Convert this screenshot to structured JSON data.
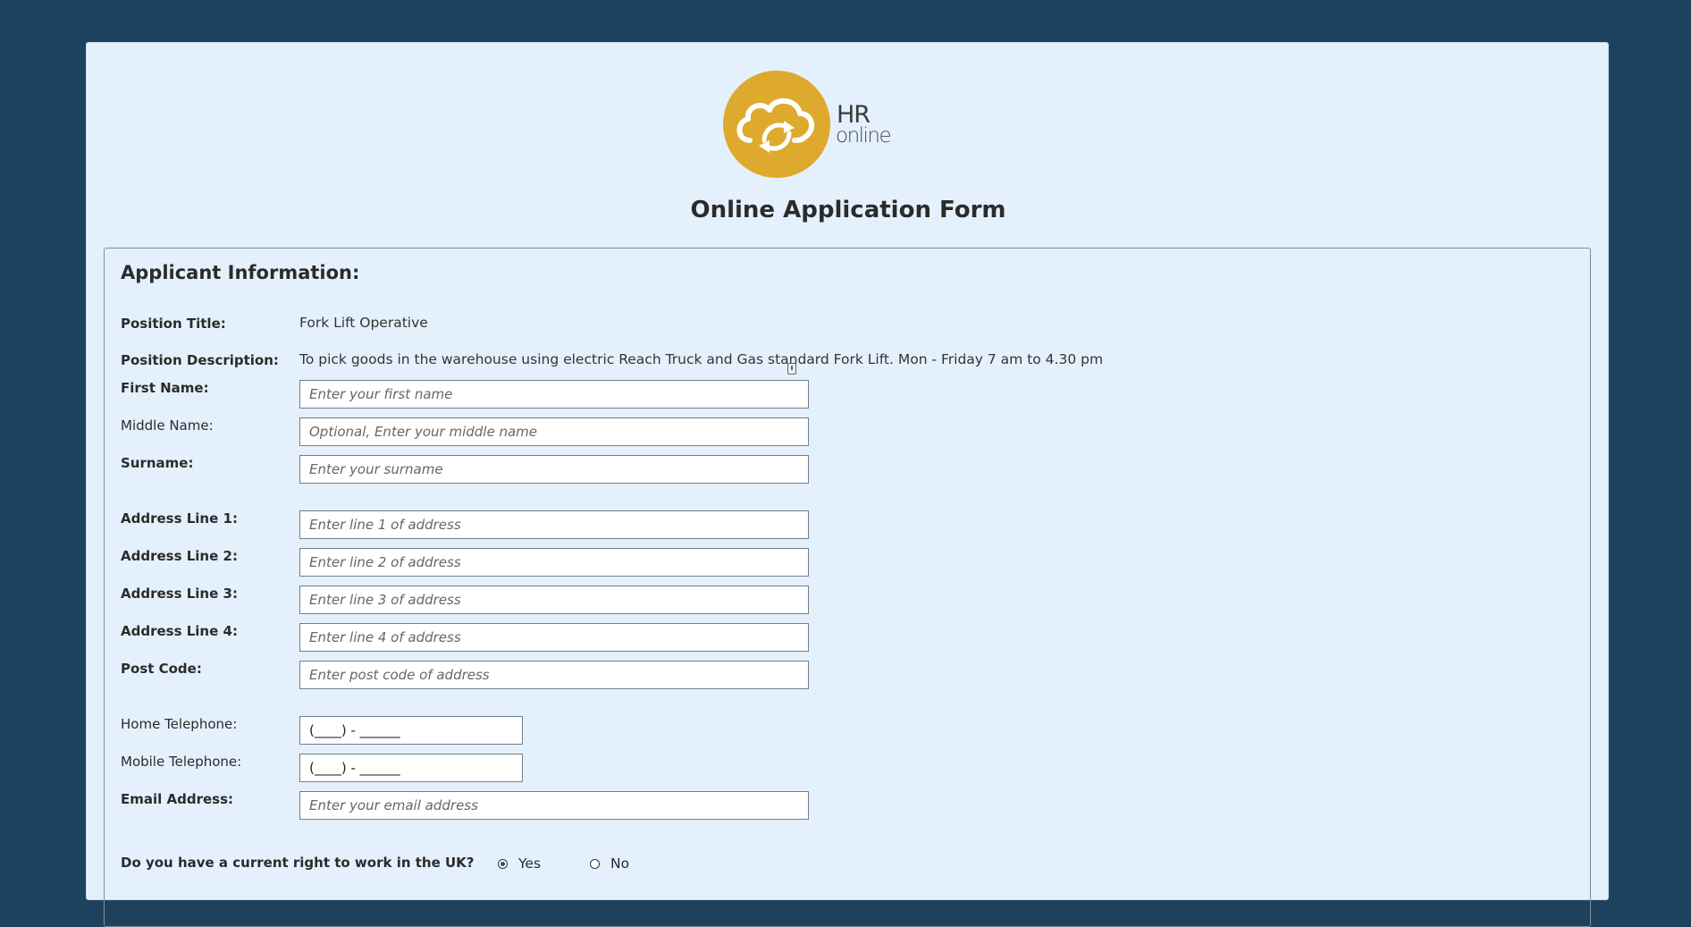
{
  "brand": {
    "logo_line1": "HR",
    "logo_line2": "online",
    "logo_color": "#deaa2d"
  },
  "page_title": "Online Application Form",
  "section_heading": "Applicant Information:",
  "position": {
    "title_label": "Position Title:",
    "title_value": "Fork Lift Operative",
    "description_label": "Position Description:",
    "description_value": "To pick goods in the warehouse using electric Reach Truck and Gas standard Fork Lift. Mon - Friday 7 am to 4.30 pm"
  },
  "fields": {
    "first_name": {
      "label": "First Name:",
      "placeholder": "Enter your first name"
    },
    "middle_name": {
      "label": "Middle Name:",
      "placeholder": "Optional, Enter your middle name"
    },
    "surname": {
      "label": "Surname:",
      "placeholder": "Enter your surname"
    },
    "address1": {
      "label": "Address Line 1:",
      "placeholder": "Enter line 1 of address"
    },
    "address2": {
      "label": "Address Line 2:",
      "placeholder": "Enter line 2 of address"
    },
    "address3": {
      "label": "Address Line 3:",
      "placeholder": "Enter line 3 of address"
    },
    "address4": {
      "label": "Address Line 4:",
      "placeholder": "Enter line 4 of address"
    },
    "postcode": {
      "label": "Post Code:",
      "placeholder": "Enter post code of address"
    },
    "home_phone": {
      "label": "Home Telephone:",
      "placeholder": "(____) - ______"
    },
    "mobile_phone": {
      "label": "Mobile Telephone:",
      "placeholder": "(____) - ______"
    },
    "email": {
      "label": "Email Address:",
      "placeholder": "Enter your email address"
    }
  },
  "right_to_work": {
    "question": "Do you have a current right to work in the UK?",
    "yes_label": "Yes",
    "no_label": "No",
    "selected": "Yes"
  },
  "colors": {
    "page_background": "#1e425e",
    "card_background": "#e4f1fd"
  }
}
